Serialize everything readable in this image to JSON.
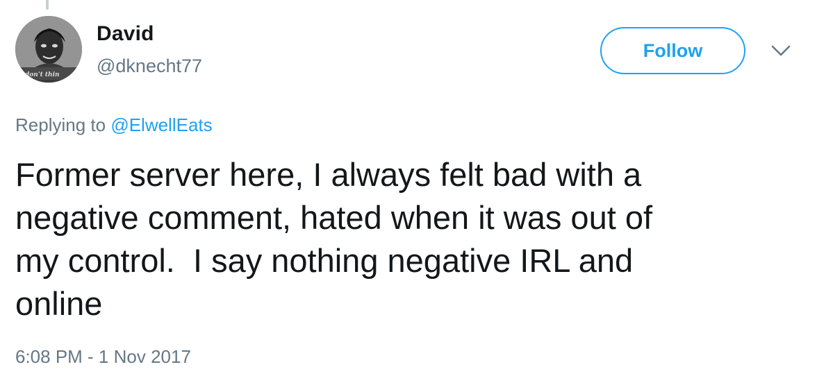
{
  "user": {
    "display_name": "David",
    "handle": "@dknecht77",
    "avatar_caption": "don't thin"
  },
  "follow_button": {
    "label": "Follow"
  },
  "reply": {
    "prefix": "Replying to",
    "mention": "@ElwellEats"
  },
  "tweet": {
    "text": "Former server here, I always felt bad with a\nnegative comment, hated when it was out of\nmy control.  I say nothing negative IRL and\nonline",
    "timestamp": "6:08 PM - 1 Nov 2017"
  },
  "colors": {
    "accent": "#1da1f2",
    "secondary_text": "#657786",
    "primary_text": "#14171a"
  },
  "icons": {
    "menu": "chevron-down-icon"
  }
}
